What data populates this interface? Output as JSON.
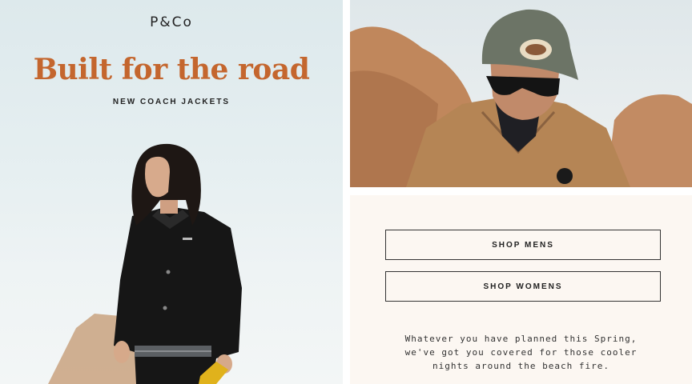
{
  "hero": {
    "logo": "P&Co",
    "headline": "Built for the road",
    "subheadline": "NEW COACH JACKETS"
  },
  "cta": {
    "mens_label": "SHOP MENS",
    "womens_label": "SHOP WOMENS"
  },
  "body_copy": {
    "line1": "Whatever you have planned this Spring,",
    "line2": "we've got you covered for those cooler",
    "line3": "nights around the beach fire."
  },
  "colors": {
    "accent": "#c4662e",
    "panel_bg": "#fcf7f2",
    "text": "#222222"
  }
}
